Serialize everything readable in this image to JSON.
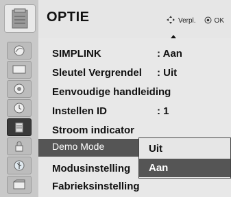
{
  "header": {
    "title": "OPTIE",
    "hint_move_icon": "four-way-arrow-icon",
    "hint_move_label": "Verpl.",
    "hint_ok_icon": "ok-circle-icon",
    "hint_ok_label": "OK"
  },
  "sidebar": {
    "icons": [
      "satellite-icon",
      "tv-screen-icon",
      "speaker-icon",
      "clock-icon",
      "options-icon",
      "lock-icon",
      "usb-icon",
      "film-icon"
    ],
    "selected": "options-icon"
  },
  "menu": {
    "items": [
      {
        "label": "SIMPLINK",
        "value": ": Aan"
      },
      {
        "label": "Sleutel Vergrendel",
        "value": ": Uit"
      },
      {
        "label": "Eenvoudige handleiding",
        "value": ""
      },
      {
        "label": "Instellen ID",
        "value": ": 1"
      },
      {
        "label": "Stroom indicator",
        "value": ""
      },
      {
        "label": "Demo Mode",
        "value": ""
      },
      {
        "label": "Modusinstelling",
        "value": ""
      },
      {
        "label": "Fabrieksinstelling",
        "value": ""
      }
    ],
    "active_item": "Demo Mode"
  },
  "popup": {
    "options": [
      "Uit",
      "Aan"
    ],
    "selected": "Aan"
  },
  "colors": {
    "highlight": "#555555",
    "panel": "#e8e8e8"
  }
}
